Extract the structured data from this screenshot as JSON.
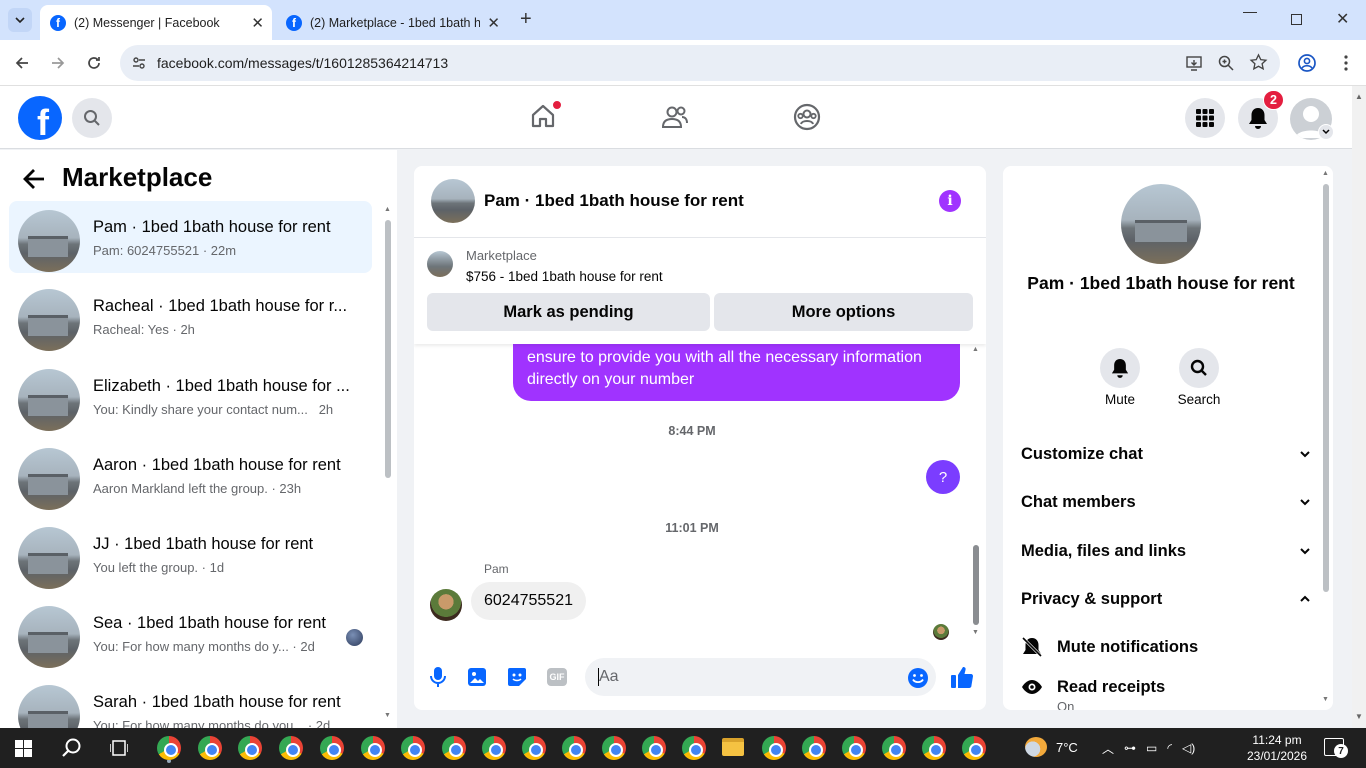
{
  "browser": {
    "tabs": [
      {
        "title": "(2) Messenger | Facebook",
        "active": true
      },
      {
        "title": "(2) Marketplace - 1bed 1bath h",
        "active": false
      }
    ],
    "url": "facebook.com/messages/t/1601285364214713"
  },
  "fbnav": {
    "notification_count": "2"
  },
  "sidebar": {
    "title": "Marketplace",
    "conversations": [
      {
        "title": "Pam · 1bed 1bath house for rent",
        "preview": "Pam: 6024755521 · 22m",
        "selected": true
      },
      {
        "title": "Racheal · 1bed 1bath house for r...",
        "preview": "Racheal: Yes · 2h"
      },
      {
        "title": "Elizabeth · 1bed 1bath house for ...",
        "preview": "You: Kindly share your contact num...   2h"
      },
      {
        "title": "Aaron · 1bed 1bath house for rent",
        "preview": "Aaron Markland left the group. · 23h"
      },
      {
        "title": "JJ · 1bed 1bath house for rent",
        "preview": "You left the group. · 1d"
      },
      {
        "title": "Sea · 1bed 1bath house for rent",
        "preview": "You: For how many months do y... · 2d"
      },
      {
        "title": "Sarah · 1bed 1bath house for rent",
        "preview": "You: For how many months do you... · 2d"
      }
    ]
  },
  "chat": {
    "header_title": "Pam · 1bed 1bath house for rent",
    "listing_source": "Marketplace",
    "listing_title": "$756 - 1bed 1bath house for rent",
    "mark_pending": "Mark as pending",
    "more_options": "More options",
    "outgoing_message": "Kindly share your contact number with us, and we will ensure to provide you with all the necessary information directly on your number",
    "time1": "8:44 PM",
    "question_bubble": "?",
    "time2": "11:01 PM",
    "sender": "Pam",
    "incoming_message": "6024755521",
    "composer_placeholder": "Aa",
    "gif_label": "GIF"
  },
  "info_panel": {
    "name": "Pam · 1bed 1bath house for rent",
    "mute_label": "Mute",
    "search_label": "Search",
    "sections": [
      "Customize chat",
      "Chat members",
      "Media, files and links",
      "Privacy & support"
    ],
    "mute_notifications": "Mute notifications",
    "read_receipts": "Read receipts",
    "read_receipts_state": "On"
  },
  "taskbar": {
    "weather": "7°C",
    "time": "11:24 pm",
    "date": "23/01/2026",
    "notif_count": "7"
  },
  "colors": {
    "accent": "#0866ff",
    "outgoing_bubble": "#a033ff",
    "question_bubble": "#7b3dff"
  }
}
